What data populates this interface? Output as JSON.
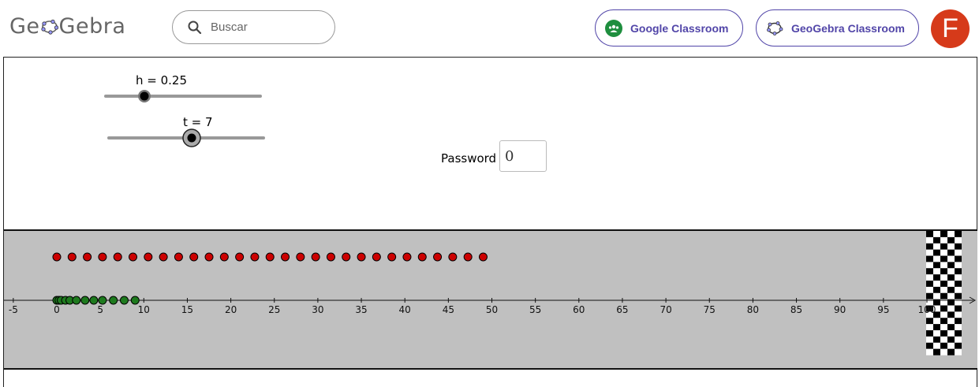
{
  "header": {
    "logo_text": "GeoGebra",
    "search_placeholder": "Buscar",
    "google_classroom_label": "Google Classroom",
    "geogebra_classroom_label": "GeoGebra Classroom",
    "avatar_letter": "F",
    "accent_color": "#5145a8",
    "avatar_color": "#d63a1a"
  },
  "applet": {
    "slider_h": {
      "label": "h = 0.25",
      "value": 0.25
    },
    "slider_t": {
      "label": "t = 7",
      "value": 7
    },
    "password": {
      "label": "Password",
      "value": "0"
    }
  },
  "graph": {
    "background": "#c0c0c0",
    "x_ticks": [
      "-5",
      "0",
      "5",
      "10",
      "15",
      "20",
      "25",
      "30",
      "35",
      "40",
      "45",
      "50",
      "55",
      "60",
      "65",
      "70",
      "75",
      "80",
      "85",
      "90",
      "95",
      "100"
    ],
    "red_points_x": [
      0,
      1.75,
      3.5,
      5.25,
      7,
      8.75,
      10.5,
      12.25,
      14,
      15.75,
      17.5,
      19.25,
      21,
      22.75,
      24.5,
      26.25,
      28,
      29.75,
      31.5,
      33.25,
      35,
      36.75,
      38.5,
      40.25,
      42,
      43.75,
      45.5,
      47.25,
      49
    ],
    "green_points_x": [
      0,
      0.25,
      0.5,
      1,
      1.5,
      2.25,
      3.25,
      4.25,
      5.25,
      6.5,
      7.75,
      9
    ],
    "red_color": "#cc0000",
    "green_color": "#1e7a1e",
    "finish_flag": "checkered"
  }
}
